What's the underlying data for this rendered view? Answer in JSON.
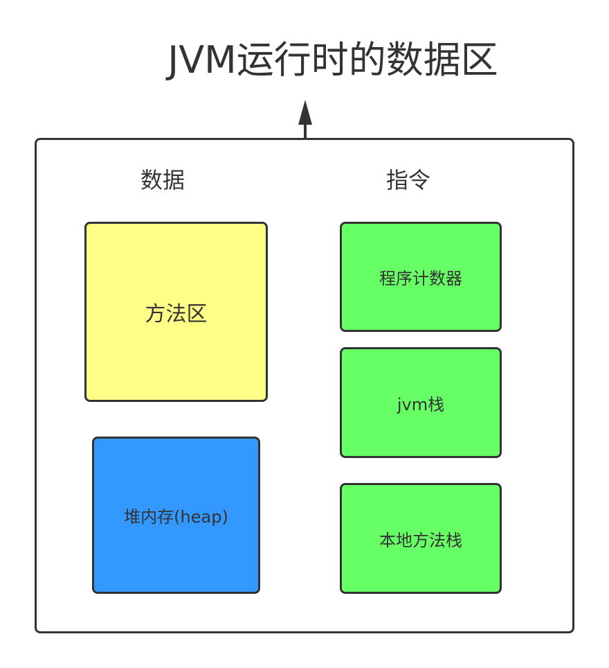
{
  "title": "JVM运行时的数据区",
  "columns": {
    "data_label": "数据",
    "instruction_label": "指令"
  },
  "data_areas": {
    "method_area": "方法区",
    "heap": "堆内存(heap)"
  },
  "instruction_areas": {
    "program_counter": "程序计数器",
    "jvm_stack": "jvm栈",
    "native_method_stack": "本地方法栈"
  },
  "colors": {
    "stroke": "#333333",
    "method_area_fill": "#ffff88",
    "heap_fill": "#3399ff",
    "instruction_fill": "#66ff66"
  }
}
